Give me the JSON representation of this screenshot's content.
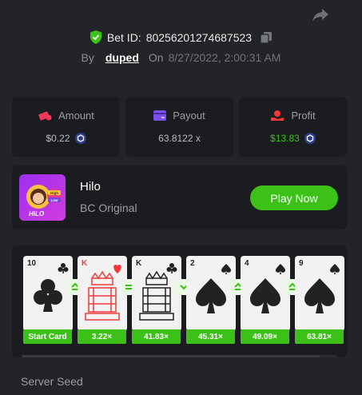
{
  "bet": {
    "label": "Bet ID:",
    "id": "80256201274687523",
    "by_label": "By",
    "user": "duped",
    "on_label": "On",
    "date": "8/27/2022, 2:00:31 AM"
  },
  "stats": {
    "amount": {
      "label": "Amount",
      "value": "$0.22"
    },
    "payout": {
      "label": "Payout",
      "value": "63.8122 x"
    },
    "profit": {
      "label": "Profit",
      "value": "$13.83"
    }
  },
  "game": {
    "name": "Hilo",
    "provider": "BC Original",
    "play_label": "Play Now",
    "thumb_text": "HILO",
    "thumb_tag_high": "High",
    "thumb_tag_low": "Low"
  },
  "cards": [
    {
      "rank": "10",
      "suit": "clubs",
      "color": "black",
      "multiplier": "Start Card"
    },
    {
      "rank": "K",
      "suit": "hearts",
      "color": "red",
      "multiplier": "3.22×",
      "prev_action": "higher"
    },
    {
      "rank": "K",
      "suit": "clubs",
      "color": "black",
      "multiplier": "41.83×",
      "prev_action": "equal"
    },
    {
      "rank": "2",
      "suit": "spades",
      "color": "black",
      "multiplier": "45.31×",
      "prev_action": "lower"
    },
    {
      "rank": "4",
      "suit": "spades",
      "color": "black",
      "multiplier": "49.09×",
      "prev_action": "higher"
    },
    {
      "rank": "9",
      "suit": "spades",
      "color": "black",
      "multiplier": "63.81×",
      "prev_action": "higher"
    }
  ],
  "footer": {
    "server_seed_label": "Server Seed"
  },
  "colors": {
    "accent_green": "#3bc117",
    "panel": "#1b1c1f",
    "bg": "#232427"
  },
  "icons": [
    "share-icon",
    "shield-check-icon",
    "copy-icon",
    "amount-icon",
    "payout-icon",
    "profit-icon",
    "coin-icon"
  ]
}
